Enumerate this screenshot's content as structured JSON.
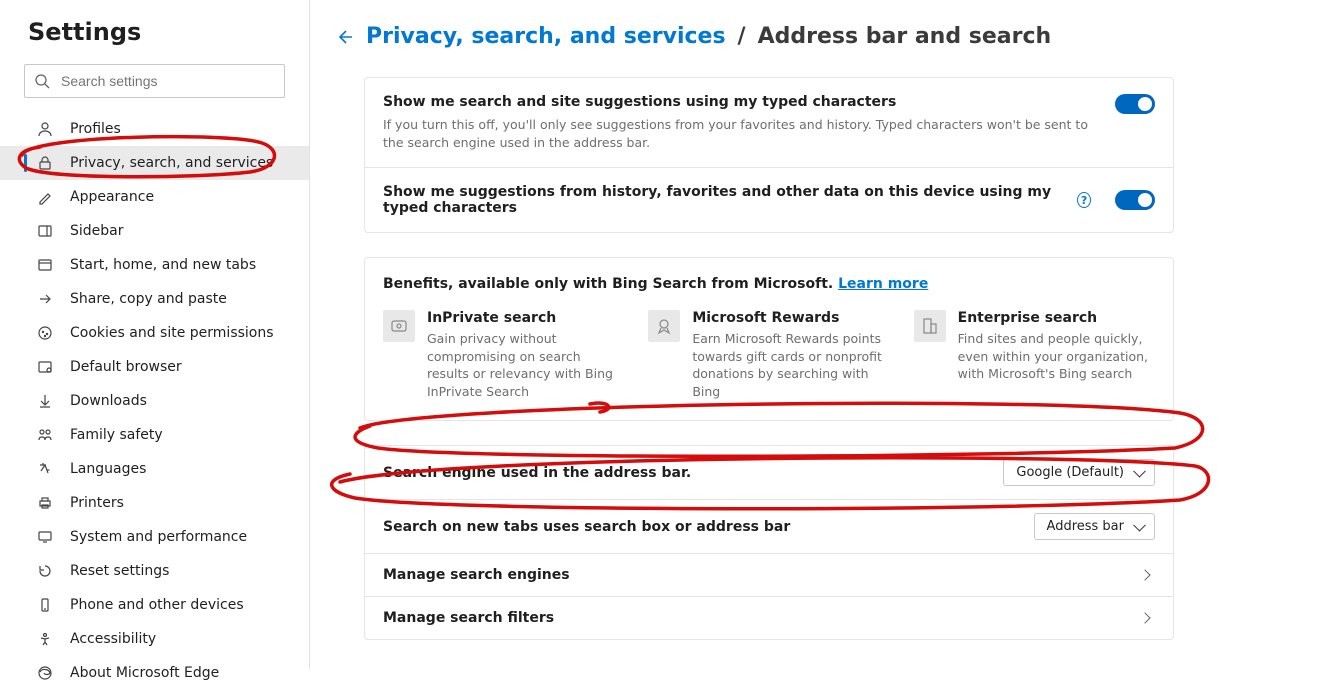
{
  "sidebar": {
    "title": "Settings",
    "search_placeholder": "Search settings",
    "items": [
      {
        "id": "profiles",
        "label": "Profiles"
      },
      {
        "id": "privacy",
        "label": "Privacy, search, and services",
        "selected": true
      },
      {
        "id": "appearance",
        "label": "Appearance"
      },
      {
        "id": "sidebar",
        "label": "Sidebar"
      },
      {
        "id": "start",
        "label": "Start, home, and new tabs"
      },
      {
        "id": "share",
        "label": "Share, copy and paste"
      },
      {
        "id": "cookies",
        "label": "Cookies and site permissions"
      },
      {
        "id": "default",
        "label": "Default browser"
      },
      {
        "id": "downloads",
        "label": "Downloads"
      },
      {
        "id": "family",
        "label": "Family safety"
      },
      {
        "id": "languages",
        "label": "Languages"
      },
      {
        "id": "printers",
        "label": "Printers"
      },
      {
        "id": "system",
        "label": "System and performance"
      },
      {
        "id": "reset",
        "label": "Reset settings"
      },
      {
        "id": "phone",
        "label": "Phone and other devices"
      },
      {
        "id": "accessibility",
        "label": "Accessibility"
      },
      {
        "id": "about",
        "label": "About Microsoft Edge"
      }
    ]
  },
  "breadcrumb": {
    "parent": "Privacy, search, and services",
    "separator": "/",
    "current": "Address bar and search"
  },
  "suggestions": {
    "row1_title": "Show me search and site suggestions using my typed characters",
    "row1_desc": "If you turn this off, you'll only see suggestions from your favorites and history. Typed characters won't be sent to the search engine used in the address bar.",
    "row2_title": "Show me suggestions from history, favorites and other data on this device using my typed characters"
  },
  "benefits": {
    "heading_prefix": "Benefits, available only with Bing Search from Microsoft. ",
    "learn_more": "Learn more",
    "items": [
      {
        "title": "InPrivate search",
        "desc": "Gain privacy without compromising on search results or relevancy with Bing InPrivate Search"
      },
      {
        "title": "Microsoft Rewards",
        "desc": "Earn Microsoft Rewards points towards gift cards or nonprofit donations by searching with Bing"
      },
      {
        "title": "Enterprise search",
        "desc": "Find sites and people quickly, even within your organization, with Microsoft's Bing search"
      }
    ]
  },
  "options": {
    "engine_label": "Search engine used in the address bar.",
    "engine_value": "Google (Default)",
    "newtab_label": "Search on new tabs uses search box or address bar",
    "newtab_value": "Address bar",
    "manage_engines": "Manage search engines",
    "manage_filters": "Manage search filters"
  }
}
